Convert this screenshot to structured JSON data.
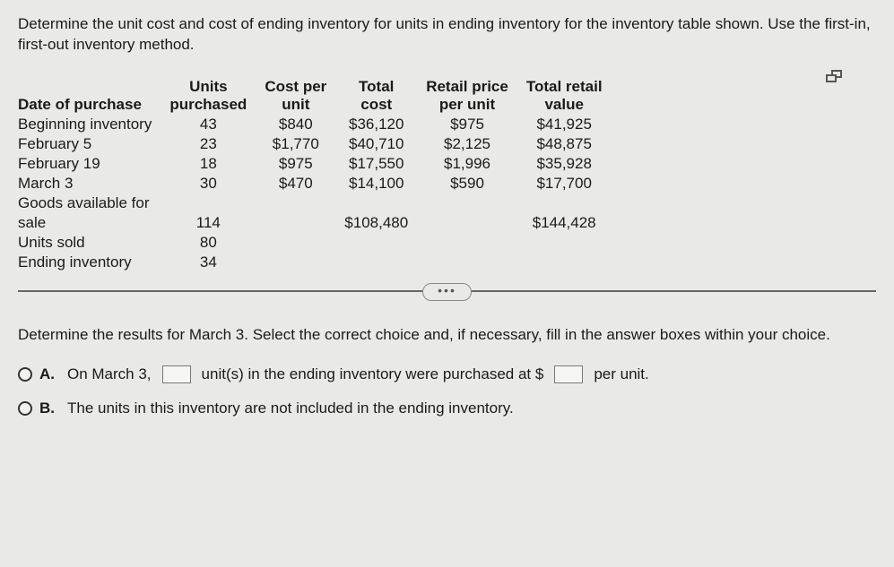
{
  "instruction": "Determine the unit cost and cost of ending inventory for units in ending inventory for the inventory table shown. Use the first-in, first-out inventory method.",
  "headers": {
    "date": "Date of purchase",
    "units_l1": "Units",
    "units_l2": "purchased",
    "cost_l1": "Cost per",
    "cost_l2": "unit",
    "total_l1": "Total",
    "total_l2": "cost",
    "retail_l1": "Retail price",
    "retail_l2": "per unit",
    "rv_l1": "Total retail",
    "rv_l2": "value"
  },
  "rows": [
    {
      "label": "Beginning inventory",
      "units": "43",
      "cpu": "$840",
      "total": "$36,120",
      "rpu": "$975",
      "trv": "$41,925"
    },
    {
      "label": "February 5",
      "units": "23",
      "cpu": "$1,770",
      "total": "$40,710",
      "rpu": "$2,125",
      "trv": "$48,875"
    },
    {
      "label": "February 19",
      "units": "18",
      "cpu": "$975",
      "total": "$17,550",
      "rpu": "$1,996",
      "trv": "$35,928"
    },
    {
      "label": "March 3",
      "units": "30",
      "cpu": "$470",
      "total": "$14,100",
      "rpu": "$590",
      "trv": "$17,700"
    }
  ],
  "summary": {
    "gafs_label_l1": "Goods available for",
    "gafs_label_l2": "sale",
    "gafs_units": "114",
    "gafs_total": "$108,480",
    "gafs_trv": "$144,428",
    "sold_label": "Units sold",
    "sold_units": "80",
    "ending_label": "Ending inventory",
    "ending_units": "34"
  },
  "sub_question": "Determine the results for March 3. Select the correct choice and, if necessary, fill in the answer boxes within your choice.",
  "choiceA": {
    "letter": "A.",
    "pre": "On March 3,",
    "mid": "unit(s) in the ending inventory were purchased at $",
    "post": "per unit."
  },
  "choiceB": {
    "letter": "B.",
    "text": "The units in this inventory are not included in the ending inventory."
  },
  "ellipsis": "•••"
}
